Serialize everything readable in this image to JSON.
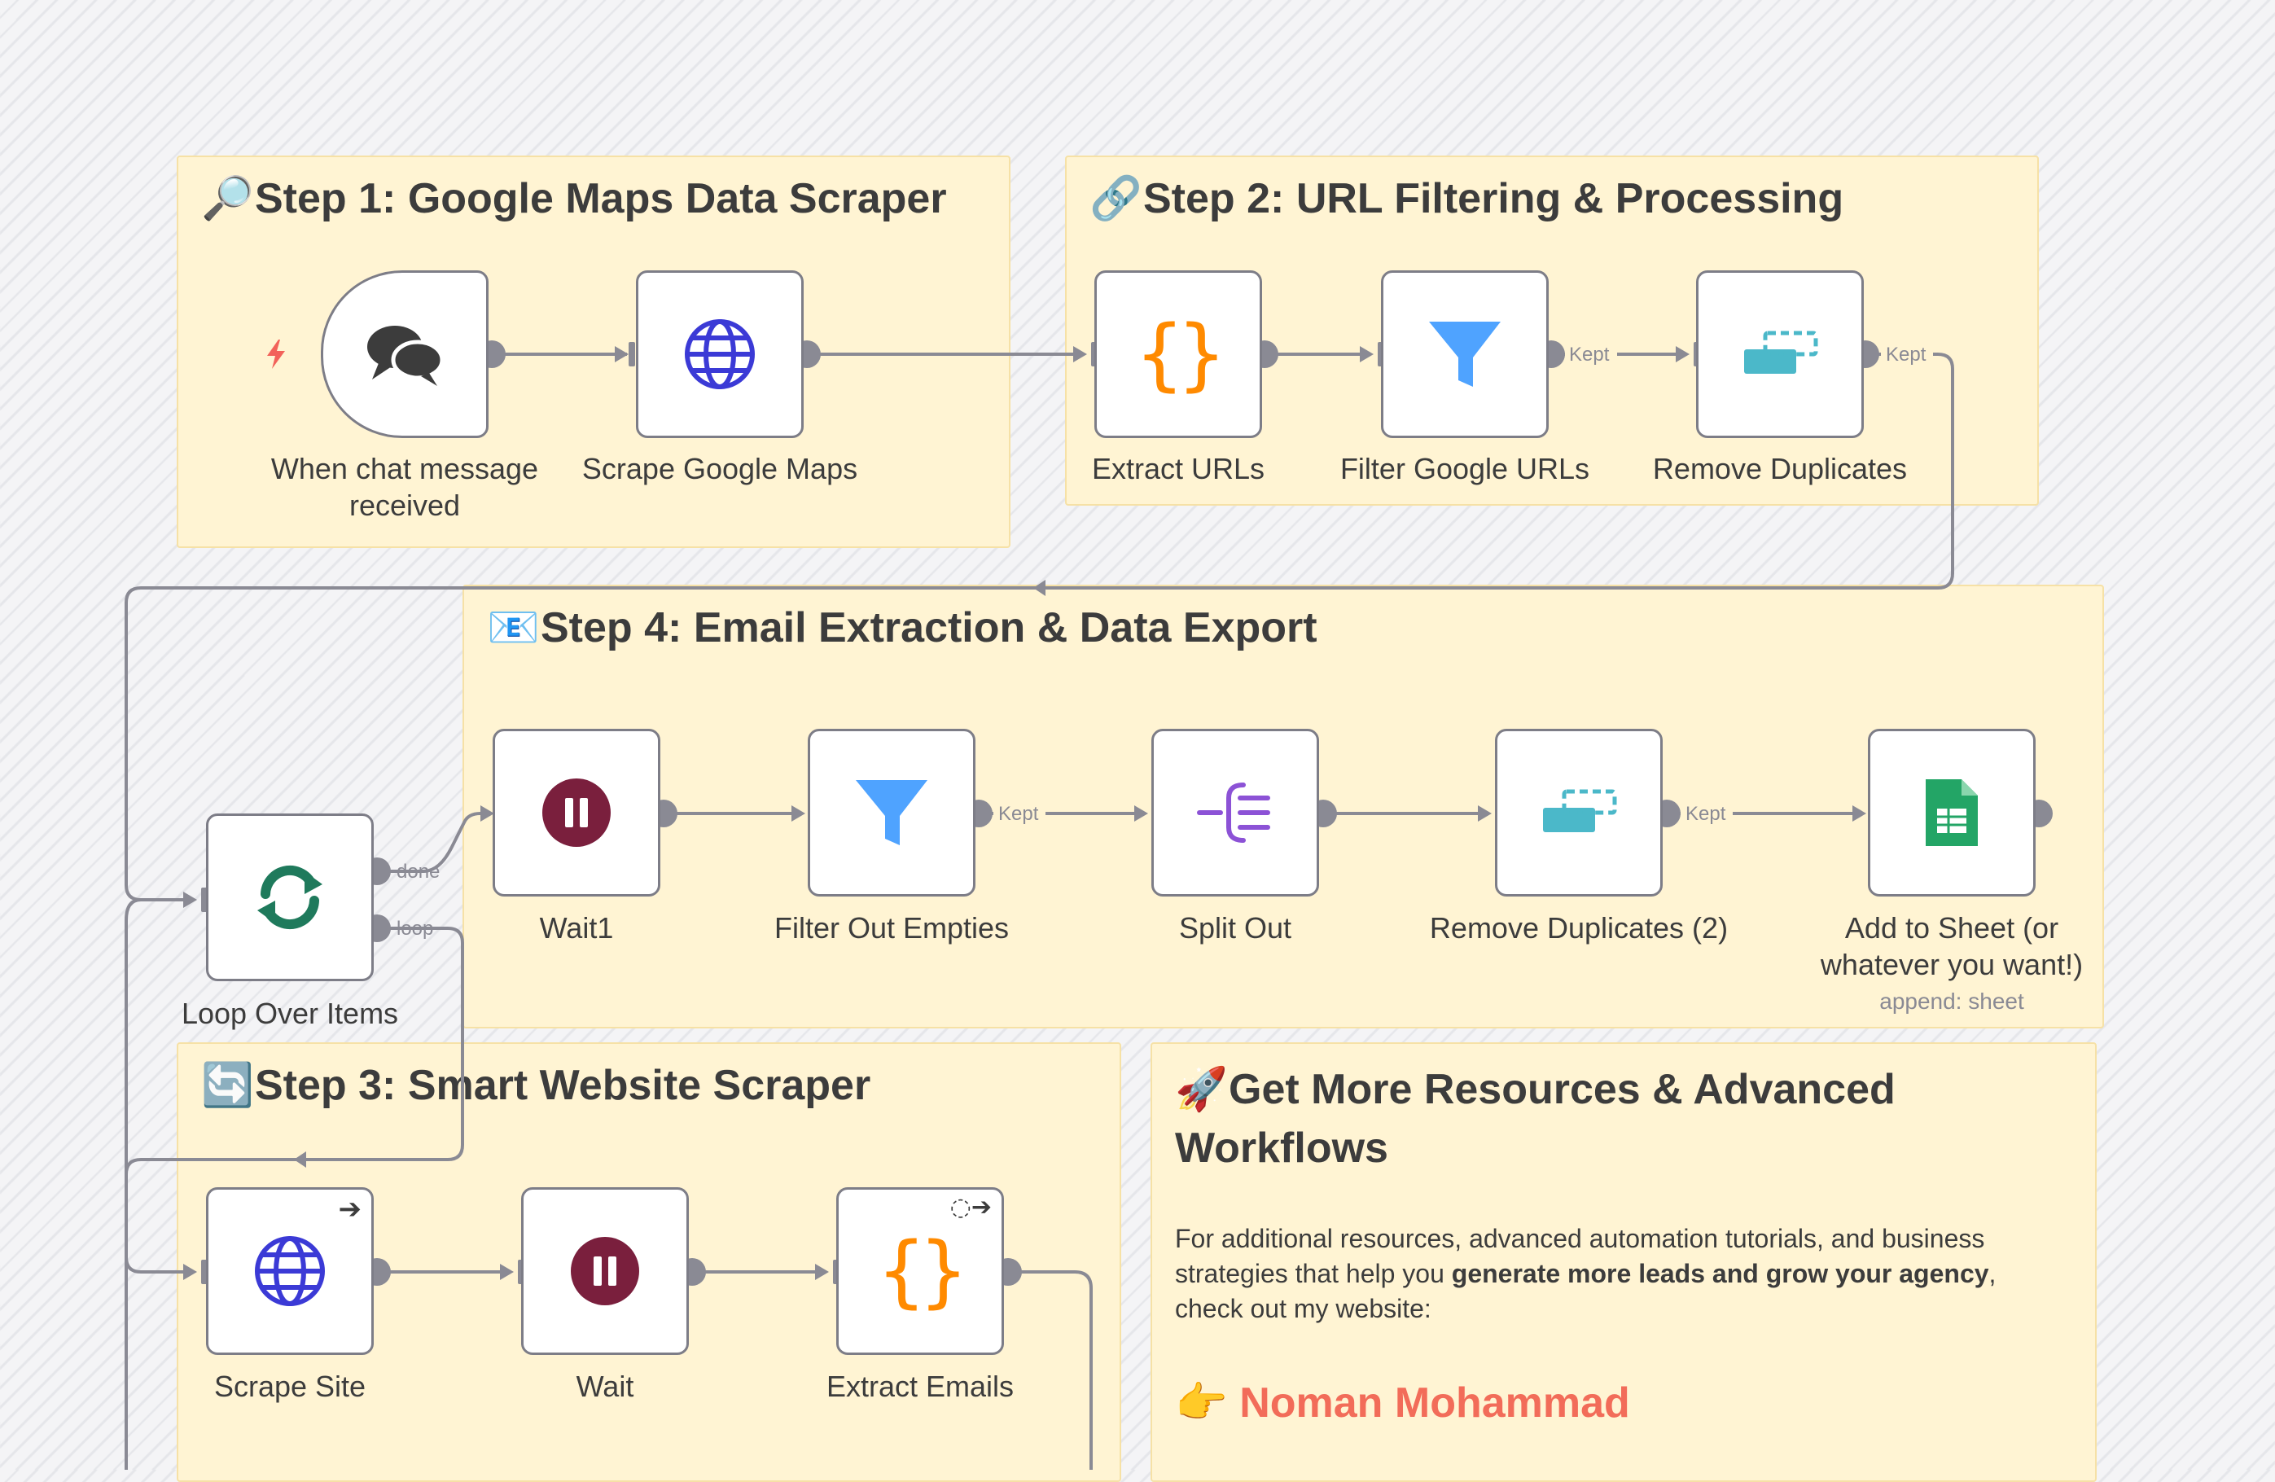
{
  "colors": {
    "sticky_bg": "#fff4d3",
    "node_border": "#7d7d87",
    "wire": "#8a8a94",
    "accent_link": "#f26c59",
    "code_orange": "#ff8a00",
    "filter_blue": "#4fa3ff",
    "dedupe_teal": "#4bb8c9",
    "wait_maroon": "#7a1f3d",
    "loop_green": "#1f7a5c",
    "split_purple": "#8c52d6",
    "sheets_green": "#23a566",
    "globe_blue": "#3b3ad6"
  },
  "stickies": {
    "step1": {
      "emoji": "🔎",
      "title": "Step 1: Google Maps Data Scraper"
    },
    "step2": {
      "emoji": "🔗",
      "title": "Step 2: URL Filtering & Processing"
    },
    "step4": {
      "emoji": "📧",
      "title": "Step 4: Email Extraction & Data Export"
    },
    "step3": {
      "emoji": "🔄",
      "title": "Step 3: Smart Website Scraper"
    },
    "resources": {
      "emoji": "🚀",
      "title_line1": "Get More Resources & Advanced",
      "title_line2": "Workflows",
      "body_part1": "For additional resources, advanced automation tutorials, and business strategies that help you ",
      "body_bold": "generate more leads and grow your agency",
      "body_part2": ", check out my website:",
      "link_emoji": "👉",
      "link_text": "Noman Mohammad"
    }
  },
  "nodes": {
    "chat_trigger": {
      "label_line1": "When chat message",
      "label_line2": "received",
      "icon": "chat-bubbles-icon"
    },
    "scrape_maps": {
      "label": "Scrape Google Maps",
      "icon": "globe-icon"
    },
    "extract_urls": {
      "label": "Extract URLs",
      "icon": "code-braces-icon"
    },
    "filter_google": {
      "label": "Filter Google URLs",
      "icon": "filter-icon"
    },
    "remove_dupes": {
      "label": "Remove Duplicates",
      "icon": "dedupe-icon"
    },
    "loop_items": {
      "label": "Loop Over Items",
      "icon": "loop-icon"
    },
    "wait1": {
      "label": "Wait1",
      "icon": "pause-icon"
    },
    "filter_empties": {
      "label": "Filter Out Empties",
      "icon": "filter-icon"
    },
    "split_out": {
      "label": "Split Out",
      "icon": "split-icon"
    },
    "remove_dupes2": {
      "label": "Remove Duplicates (2)",
      "icon": "dedupe-icon"
    },
    "add_sheet": {
      "label_line1": "Add to Sheet (or",
      "label_line2": "whatever you want!)",
      "sub": "append: sheet",
      "icon": "sheets-icon"
    },
    "scrape_site": {
      "label": "Scrape Site",
      "icon": "globe-icon"
    },
    "wait": {
      "label": "Wait",
      "icon": "pause-icon"
    },
    "extract_emails": {
      "label": "Extract Emails",
      "icon": "code-braces-icon"
    }
  },
  "edge_labels": {
    "kept": "Kept",
    "done": "done",
    "loop": "loop"
  }
}
